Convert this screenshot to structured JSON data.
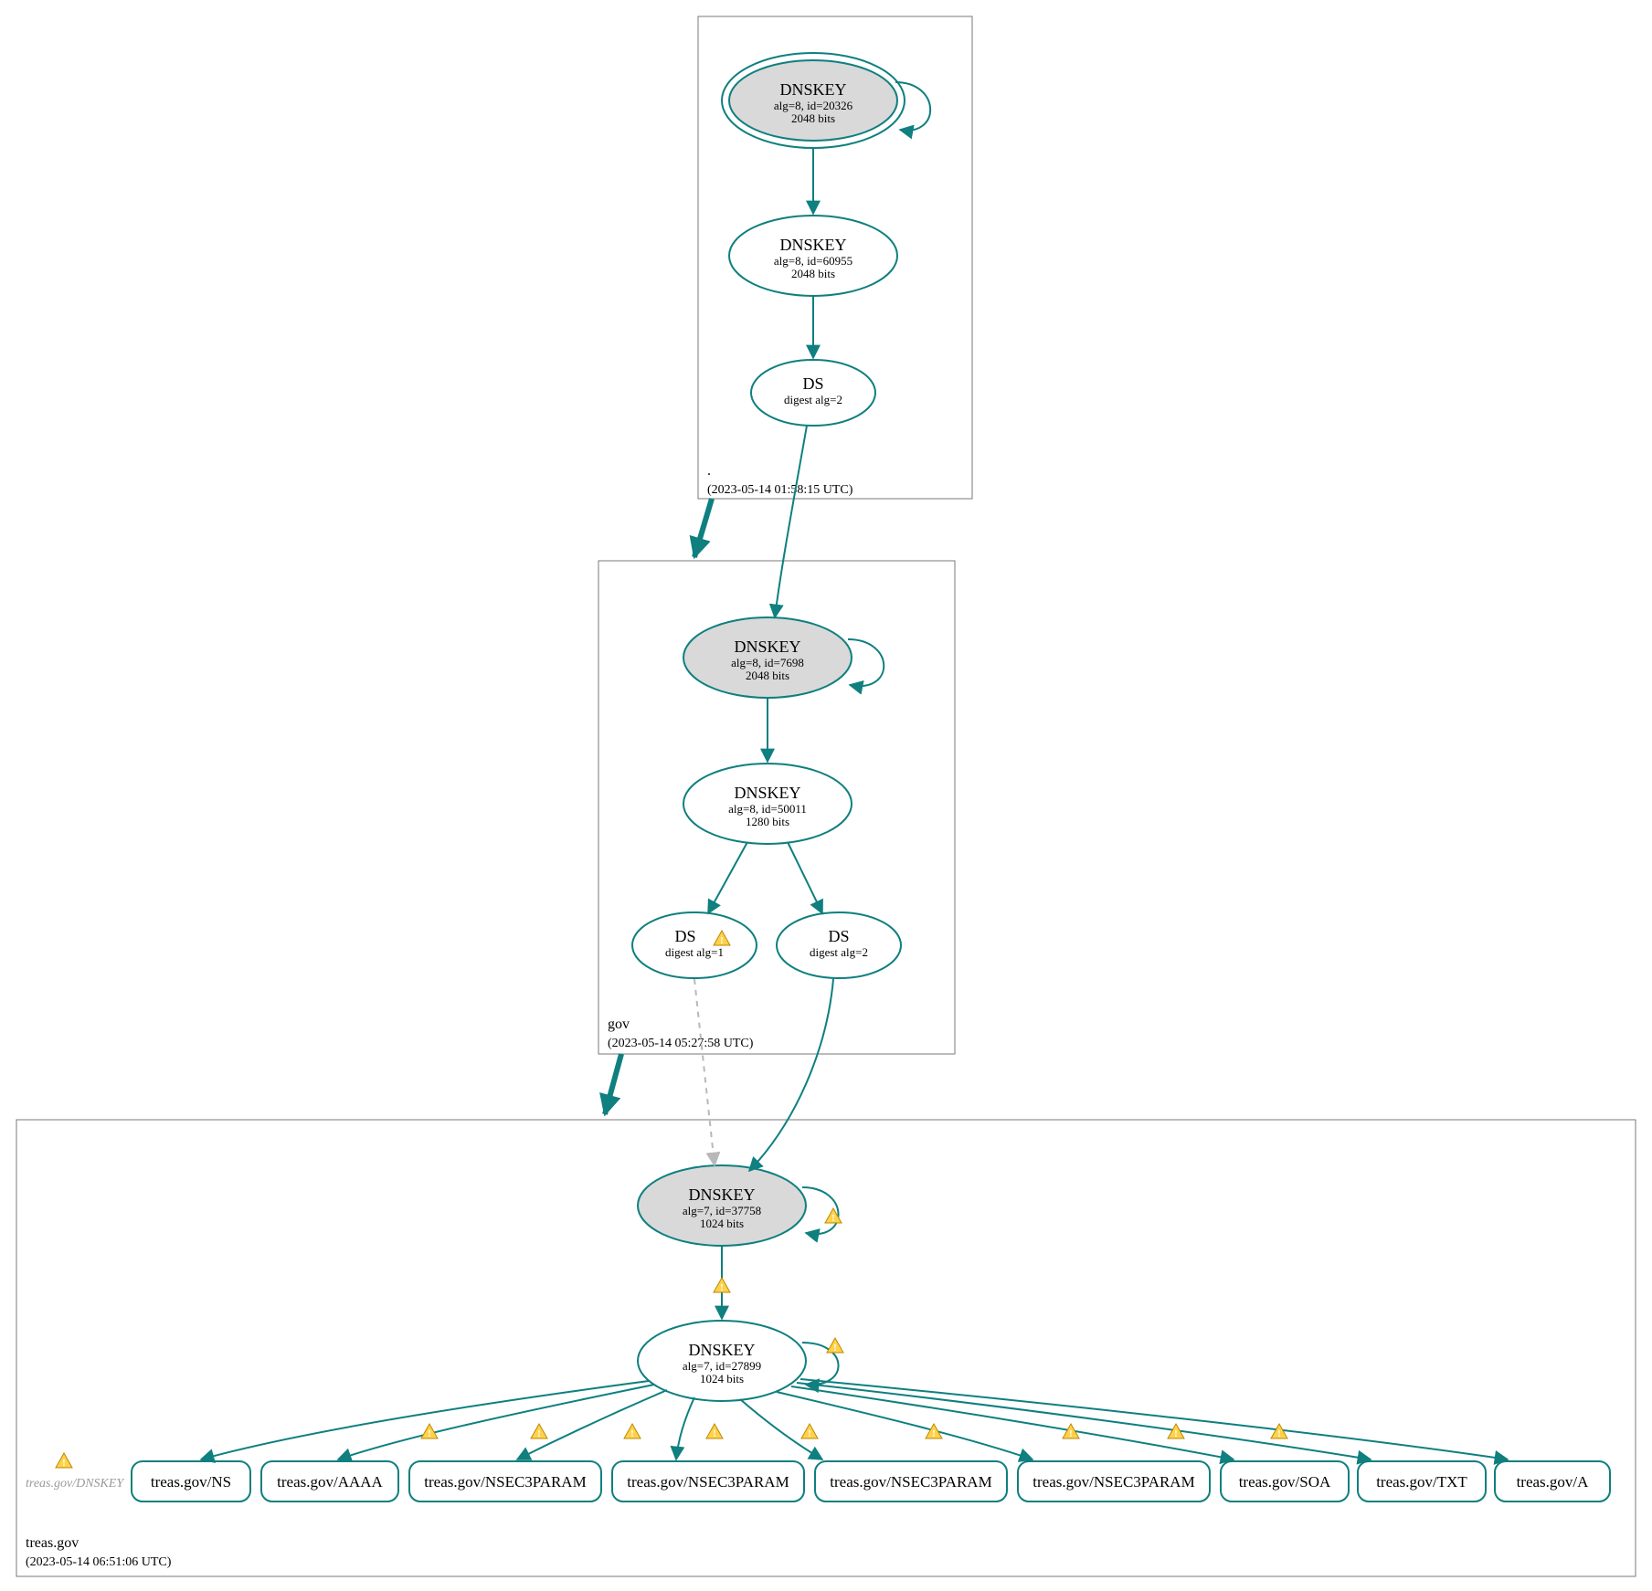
{
  "zones": {
    "root": {
      "label": ".",
      "timestamp": "(2023-05-14 01:58:15 UTC)"
    },
    "gov": {
      "label": "gov",
      "timestamp": "(2023-05-14 05:27:58 UTC)"
    },
    "treas": {
      "label": "treas.gov",
      "timestamp": "(2023-05-14 06:51:06 UTC)"
    }
  },
  "nodes": {
    "root_ksk": {
      "title": "DNSKEY",
      "l1": "alg=8, id=20326",
      "l2": "2048 bits"
    },
    "root_zsk": {
      "title": "DNSKEY",
      "l1": "alg=8, id=60955",
      "l2": "2048 bits"
    },
    "root_ds": {
      "title": "DS",
      "l1": "digest alg=2",
      "l2": ""
    },
    "gov_ksk": {
      "title": "DNSKEY",
      "l1": "alg=8, id=7698",
      "l2": "2048 bits"
    },
    "gov_zsk": {
      "title": "DNSKEY",
      "l1": "alg=8, id=50011",
      "l2": "1280 bits"
    },
    "gov_ds1": {
      "title": "DS",
      "l1": "digest alg=1",
      "l2": ""
    },
    "gov_ds2": {
      "title": "DS",
      "l1": "digest alg=2",
      "l2": ""
    },
    "treas_ksk": {
      "title": "DNSKEY",
      "l1": "alg=7, id=37758",
      "l2": "1024 bits"
    },
    "treas_zsk": {
      "title": "DNSKEY",
      "l1": "alg=7, id=27899",
      "l2": "1024 bits"
    }
  },
  "rrsets": {
    "grey": "treas.gov/DNSKEY",
    "r0": "treas.gov/NS",
    "r1": "treas.gov/AAAA",
    "r2": "treas.gov/NSEC3PARAM",
    "r3": "treas.gov/NSEC3PARAM",
    "r4": "treas.gov/NSEC3PARAM",
    "r5": "treas.gov/NSEC3PARAM",
    "r6": "treas.gov/SOA",
    "r7": "treas.gov/TXT",
    "r8": "treas.gov/A"
  }
}
